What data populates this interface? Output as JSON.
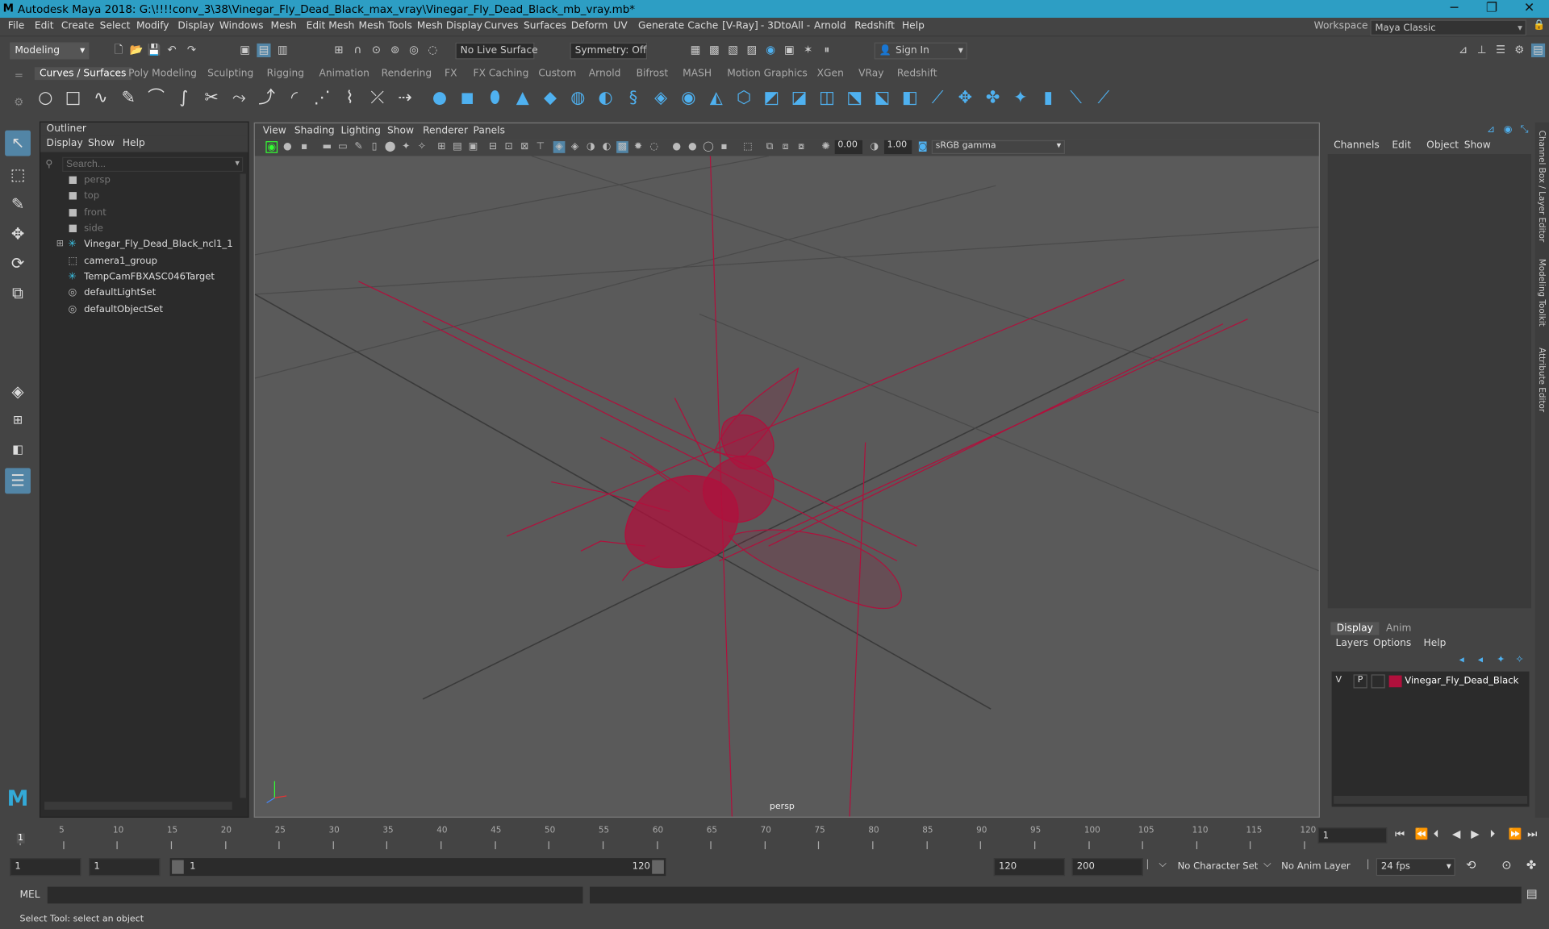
{
  "window": {
    "title": "Autodesk Maya 2018: G:\\!!!!conv_3\\38\\Vinegar_Fly_Dead_Black_max_vray\\Vinegar_Fly_Dead_Black_mb_vray.mb*",
    "minimize": "─",
    "maximize": "❐",
    "close": "✕"
  },
  "menubar": {
    "items": [
      "File",
      "Edit",
      "Create",
      "Select",
      "Modify",
      "Display",
      "Windows",
      "Mesh",
      "Edit Mesh",
      "Mesh Tools",
      "Mesh Display",
      "Curves",
      "Surfaces",
      "Deform",
      "UV",
      "Generate",
      "Cache",
      "V-Ray",
      "- 3DtoAll -",
      "Arnold",
      "Redshift",
      "Help"
    ],
    "workspace_label": "Workspace :",
    "workspace_value": "Maya Classic"
  },
  "statusline": {
    "mode": "Modeling",
    "live_surface": "No Live Surface",
    "symmetry": "Symmetry: Off",
    "sign_in": "Sign In"
  },
  "shelf": {
    "tabs": [
      "Curves / Surfaces",
      "Poly Modeling",
      "Sculpting",
      "Rigging",
      "Animation",
      "Rendering",
      "FX",
      "FX Caching",
      "Custom",
      "Arnold",
      "Bifrost",
      "MASH",
      "Motion Graphics",
      "XGen",
      "VRay",
      "Redshift"
    ],
    "active_tab": "Curves / Surfaces"
  },
  "outliner": {
    "title": "Outliner",
    "menus": [
      "Display",
      "Show",
      "Help"
    ],
    "search_placeholder": "Search...",
    "items": [
      {
        "label": "persp",
        "icon": "camera-icon",
        "dim": true
      },
      {
        "label": "top",
        "icon": "camera-icon",
        "dim": true
      },
      {
        "label": "front",
        "icon": "camera-icon",
        "dim": true
      },
      {
        "label": "side",
        "icon": "camera-icon",
        "dim": true
      },
      {
        "label": "Vinegar_Fly_Dead_Black_ncl1_1",
        "icon": "joint-icon",
        "dim": false,
        "expandable": true
      },
      {
        "label": "camera1_group",
        "icon": "group-icon",
        "dim": false
      },
      {
        "label": "TempCamFBXASC046Target",
        "icon": "joint-icon",
        "dim": false
      },
      {
        "label": "defaultLightSet",
        "icon": "set-icon",
        "dim": false
      },
      {
        "label": "defaultObjectSet",
        "icon": "set-icon",
        "dim": false
      }
    ]
  },
  "viewport": {
    "menus": [
      "View",
      "Shading",
      "Lighting",
      "Show",
      "Renderer",
      "Panels"
    ],
    "near_value": "0.00",
    "far_value": "1.00",
    "color_space": "sRGB gamma",
    "camera_label": "persp",
    "wire_color": "#b0103c"
  },
  "channelbox": {
    "menus": [
      "Channels",
      "Edit",
      "Object",
      "Show"
    ]
  },
  "layers": {
    "tabs": [
      "Display",
      "Anim"
    ],
    "menus": [
      "Layers",
      "Options",
      "Help"
    ],
    "layer": {
      "v": "V",
      "p": "P",
      "name": "Vinegar_Fly_Dead_Black",
      "color": "#b0103c"
    }
  },
  "right_strip": [
    "Channel Box / Layer Editor",
    "Modeling Toolkit",
    "Attribute Editor"
  ],
  "timeline": {
    "ticks": [
      "5",
      "10",
      "15",
      "20",
      "25",
      "30",
      "35",
      "40",
      "45",
      "50",
      "55",
      "60",
      "65",
      "70",
      "75",
      "80",
      "85",
      "90",
      "95",
      "100",
      "105",
      "110",
      "115",
      "120"
    ],
    "start_marker": "1",
    "current_frame": "1"
  },
  "range": {
    "start": "1",
    "playback_start": "1",
    "slider_start": "1",
    "slider_end": "120",
    "playback_end": "120",
    "end": "200",
    "character_set": "No Character Set",
    "anim_layer": "No Anim Layer",
    "fps": "24 fps"
  },
  "commandline": {
    "label": "MEL"
  },
  "helpline": {
    "text": "Select Tool: select an object"
  }
}
